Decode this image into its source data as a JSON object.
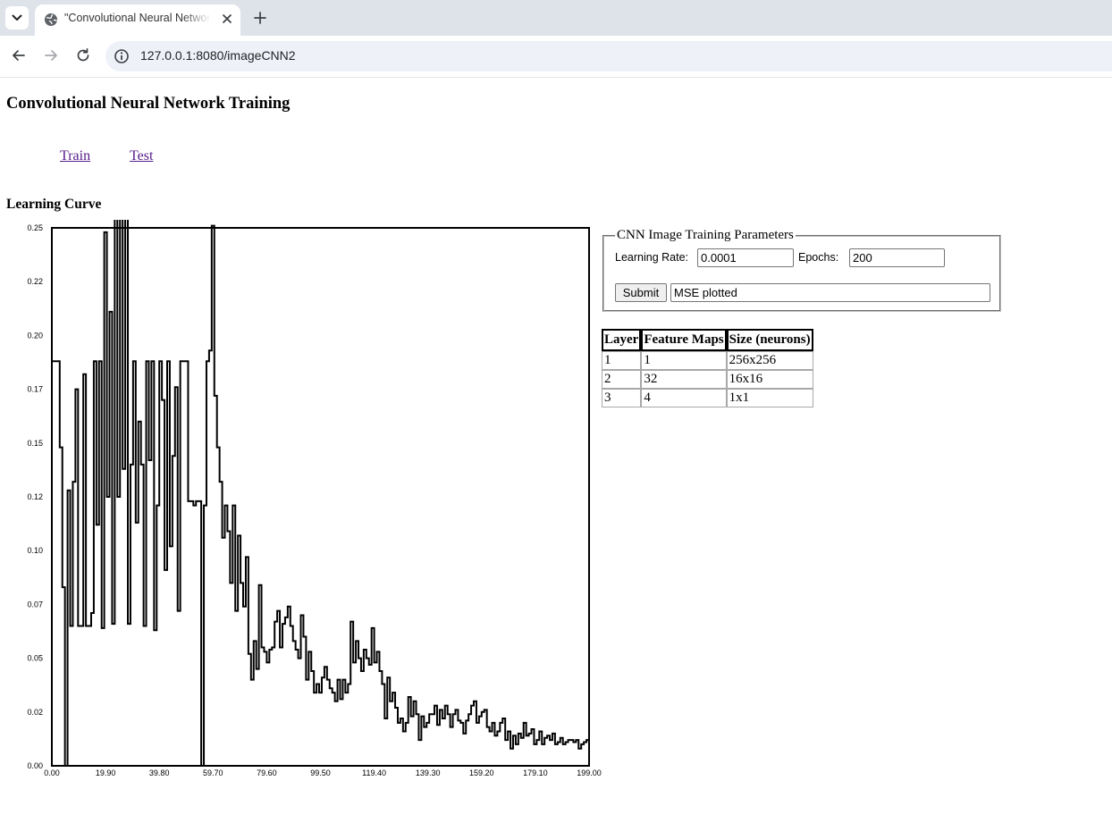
{
  "browser": {
    "tab_title": "\"Convolutional Neural Network",
    "url": "127.0.0.1:8080/imageCNN2"
  },
  "page": {
    "title": "Convolutional Neural Network Training",
    "nav": [
      {
        "label": "Train"
      },
      {
        "label": "Test"
      }
    ],
    "curve_heading": "Learning Curve"
  },
  "form": {
    "legend": "CNN Image Training Parameters",
    "learning_rate_label": "Learning Rate:",
    "learning_rate_value": "0.0001",
    "epochs_label": "Epochs:",
    "epochs_value": "200",
    "submit_label": "Submit",
    "status_value": "MSE plotted"
  },
  "layer_table": {
    "headers": [
      "Layer",
      "Feature Maps",
      "Size (neurons)"
    ],
    "rows": [
      [
        "1",
        "1",
        "256x256"
      ],
      [
        "2",
        "32",
        "16x16"
      ],
      [
        "3",
        "4",
        "1x1"
      ]
    ]
  },
  "chart_data": {
    "type": "line",
    "title": "",
    "xlabel": "",
    "ylabel": "",
    "xlim": [
      0,
      199
    ],
    "ylim": [
      0,
      0.25
    ],
    "x_ticks": [
      "0.00",
      "19.90",
      "39.80",
      "59.70",
      "79.60",
      "99.50",
      "119.40",
      "139.30",
      "159.20",
      "179.10",
      "199.00"
    ],
    "y_ticks": [
      "0.25",
      "0.22",
      "0.20",
      "0.17",
      "0.15",
      "0.12",
      "0.10",
      "0.07",
      "0.05",
      "0.02",
      "0.00"
    ],
    "grid": false,
    "legend": "none",
    "series": [
      {
        "color": "#000000",
        "values": [
          0.188,
          0.188,
          0.188,
          0.148,
          0.083,
          0.0,
          0.128,
          0.065,
          0.132,
          0.175,
          0.065,
          0.065,
          0.182,
          0.065,
          0.065,
          0.071,
          0.188,
          0.112,
          0.188,
          0.064,
          0.248,
          0.125,
          0.211,
          0.066,
          0.255,
          0.125,
          0.255,
          0.138,
          0.255,
          0.066,
          0.14,
          0.188,
          0.113,
          0.16,
          0.14,
          0.065,
          0.188,
          0.142,
          0.188,
          0.063,
          0.121,
          0.188,
          0.17,
          0.091,
          0.188,
          0.102,
          0.144,
          0.176,
          0.072,
          0.188,
          0.188,
          0.188,
          0.123,
          0.123,
          0.121,
          0.123,
          0.123,
          0.0,
          0.121,
          0.188,
          0.193,
          0.251,
          0.172,
          0.148,
          0.132,
          0.106,
          0.121,
          0.109,
          0.085,
          0.121,
          0.072,
          0.107,
          0.085,
          0.074,
          0.097,
          0.052,
          0.04,
          0.058,
          0.045,
          0.084,
          0.055,
          0.053,
          0.048,
          0.054,
          0.055,
          0.067,
          0.072,
          0.055,
          0.066,
          0.069,
          0.074,
          0.065,
          0.058,
          0.054,
          0.05,
          0.07,
          0.06,
          0.04,
          0.053,
          0.044,
          0.034,
          0.038,
          0.034,
          0.041,
          0.046,
          0.04,
          0.036,
          0.034,
          0.03,
          0.04,
          0.031,
          0.04,
          0.034,
          0.038,
          0.067,
          0.048,
          0.058,
          0.05,
          0.044,
          0.054,
          0.05,
          0.047,
          0.064,
          0.048,
          0.053,
          0.044,
          0.038,
          0.022,
          0.041,
          0.03,
          0.034,
          0.027,
          0.02,
          0.022,
          0.016,
          0.02,
          0.032,
          0.023,
          0.03,
          0.024,
          0.012,
          0.023,
          0.018,
          0.02,
          0.024,
          0.024,
          0.028,
          0.019,
          0.026,
          0.022,
          0.028,
          0.024,
          0.018,
          0.024,
          0.026,
          0.021,
          0.02,
          0.015,
          0.021,
          0.024,
          0.028,
          0.03,
          0.02,
          0.023,
          0.025,
          0.026,
          0.018,
          0.016,
          0.02,
          0.014,
          0.016,
          0.02,
          0.022,
          0.012,
          0.016,
          0.008,
          0.014,
          0.01,
          0.015,
          0.013,
          0.02,
          0.014,
          0.015,
          0.017,
          0.01,
          0.012,
          0.016,
          0.01,
          0.013,
          0.014,
          0.012,
          0.015,
          0.01,
          0.011,
          0.013,
          0.01,
          0.011,
          0.012,
          0.012,
          0.011,
          0.012,
          0.008,
          0.01,
          0.011,
          0.012,
          0.01
        ]
      }
    ]
  }
}
